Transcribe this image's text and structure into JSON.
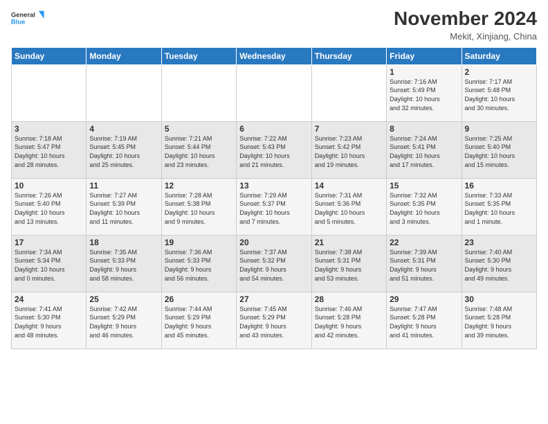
{
  "header": {
    "logo_line1": "General",
    "logo_line2": "Blue",
    "month": "November 2024",
    "location": "Mekit, Xinjiang, China"
  },
  "days_of_week": [
    "Sunday",
    "Monday",
    "Tuesday",
    "Wednesday",
    "Thursday",
    "Friday",
    "Saturday"
  ],
  "weeks": [
    [
      {
        "day": "",
        "info": ""
      },
      {
        "day": "",
        "info": ""
      },
      {
        "day": "",
        "info": ""
      },
      {
        "day": "",
        "info": ""
      },
      {
        "day": "",
        "info": ""
      },
      {
        "day": "1",
        "info": "Sunrise: 7:16 AM\nSunset: 5:49 PM\nDaylight: 10 hours\nand 32 minutes."
      },
      {
        "day": "2",
        "info": "Sunrise: 7:17 AM\nSunset: 5:48 PM\nDaylight: 10 hours\nand 30 minutes."
      }
    ],
    [
      {
        "day": "3",
        "info": "Sunrise: 7:18 AM\nSunset: 5:47 PM\nDaylight: 10 hours\nand 28 minutes."
      },
      {
        "day": "4",
        "info": "Sunrise: 7:19 AM\nSunset: 5:45 PM\nDaylight: 10 hours\nand 25 minutes."
      },
      {
        "day": "5",
        "info": "Sunrise: 7:21 AM\nSunset: 5:44 PM\nDaylight: 10 hours\nand 23 minutes."
      },
      {
        "day": "6",
        "info": "Sunrise: 7:22 AM\nSunset: 5:43 PM\nDaylight: 10 hours\nand 21 minutes."
      },
      {
        "day": "7",
        "info": "Sunrise: 7:23 AM\nSunset: 5:42 PM\nDaylight: 10 hours\nand 19 minutes."
      },
      {
        "day": "8",
        "info": "Sunrise: 7:24 AM\nSunset: 5:41 PM\nDaylight: 10 hours\nand 17 minutes."
      },
      {
        "day": "9",
        "info": "Sunrise: 7:25 AM\nSunset: 5:40 PM\nDaylight: 10 hours\nand 15 minutes."
      }
    ],
    [
      {
        "day": "10",
        "info": "Sunrise: 7:26 AM\nSunset: 5:40 PM\nDaylight: 10 hours\nand 13 minutes."
      },
      {
        "day": "11",
        "info": "Sunrise: 7:27 AM\nSunset: 5:39 PM\nDaylight: 10 hours\nand 11 minutes."
      },
      {
        "day": "12",
        "info": "Sunrise: 7:28 AM\nSunset: 5:38 PM\nDaylight: 10 hours\nand 9 minutes."
      },
      {
        "day": "13",
        "info": "Sunrise: 7:29 AM\nSunset: 5:37 PM\nDaylight: 10 hours\nand 7 minutes."
      },
      {
        "day": "14",
        "info": "Sunrise: 7:31 AM\nSunset: 5:36 PM\nDaylight: 10 hours\nand 5 minutes."
      },
      {
        "day": "15",
        "info": "Sunrise: 7:32 AM\nSunset: 5:35 PM\nDaylight: 10 hours\nand 3 minutes."
      },
      {
        "day": "16",
        "info": "Sunrise: 7:33 AM\nSunset: 5:35 PM\nDaylight: 10 hours\nand 1 minute."
      }
    ],
    [
      {
        "day": "17",
        "info": "Sunrise: 7:34 AM\nSunset: 5:34 PM\nDaylight: 10 hours\nand 0 minutes."
      },
      {
        "day": "18",
        "info": "Sunrise: 7:35 AM\nSunset: 5:33 PM\nDaylight: 9 hours\nand 58 minutes."
      },
      {
        "day": "19",
        "info": "Sunrise: 7:36 AM\nSunset: 5:33 PM\nDaylight: 9 hours\nand 56 minutes."
      },
      {
        "day": "20",
        "info": "Sunrise: 7:37 AM\nSunset: 5:32 PM\nDaylight: 9 hours\nand 54 minutes."
      },
      {
        "day": "21",
        "info": "Sunrise: 7:38 AM\nSunset: 5:31 PM\nDaylight: 9 hours\nand 53 minutes."
      },
      {
        "day": "22",
        "info": "Sunrise: 7:39 AM\nSunset: 5:31 PM\nDaylight: 9 hours\nand 51 minutes."
      },
      {
        "day": "23",
        "info": "Sunrise: 7:40 AM\nSunset: 5:30 PM\nDaylight: 9 hours\nand 49 minutes."
      }
    ],
    [
      {
        "day": "24",
        "info": "Sunrise: 7:41 AM\nSunset: 5:30 PM\nDaylight: 9 hours\nand 48 minutes."
      },
      {
        "day": "25",
        "info": "Sunrise: 7:42 AM\nSunset: 5:29 PM\nDaylight: 9 hours\nand 46 minutes."
      },
      {
        "day": "26",
        "info": "Sunrise: 7:44 AM\nSunset: 5:29 PM\nDaylight: 9 hours\nand 45 minutes."
      },
      {
        "day": "27",
        "info": "Sunrise: 7:45 AM\nSunset: 5:29 PM\nDaylight: 9 hours\nand 43 minutes."
      },
      {
        "day": "28",
        "info": "Sunrise: 7:46 AM\nSunset: 5:28 PM\nDaylight: 9 hours\nand 42 minutes."
      },
      {
        "day": "29",
        "info": "Sunrise: 7:47 AM\nSunset: 5:28 PM\nDaylight: 9 hours\nand 41 minutes."
      },
      {
        "day": "30",
        "info": "Sunrise: 7:48 AM\nSunset: 5:28 PM\nDaylight: 9 hours\nand 39 minutes."
      }
    ]
  ]
}
